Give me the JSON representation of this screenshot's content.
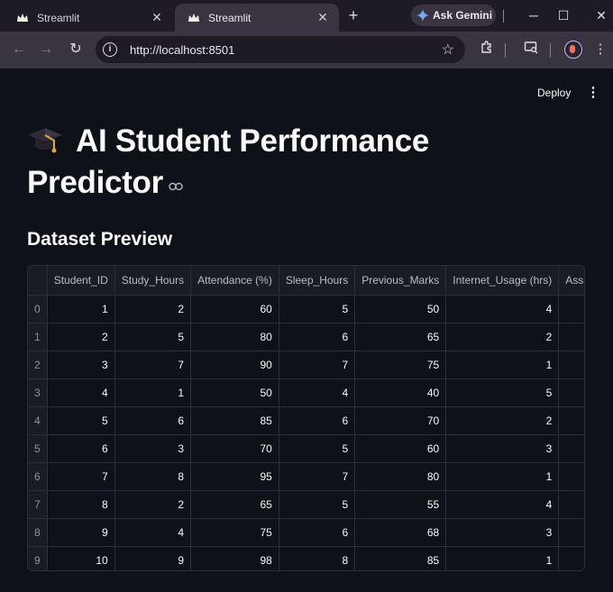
{
  "browser": {
    "tabs": [
      {
        "title": "Streamlit",
        "active": false
      },
      {
        "title": "Streamlit",
        "active": true
      }
    ],
    "new_tab": "+",
    "ask_gemini": "Ask Gemini",
    "url": "http://localhost:8501"
  },
  "app": {
    "deploy_label": "Deploy",
    "title_line1": "AI Student Performance",
    "title_line2": "Predictor",
    "subheader": "Dataset Preview"
  },
  "table": {
    "columns": [
      "",
      "Student_ID",
      "Study_Hours",
      "Attendance (%)",
      "Sleep_Hours",
      "Previous_Marks",
      "Internet_Usage (hrs)",
      "Assig"
    ],
    "rows": [
      [
        "0",
        "1",
        "2",
        "60",
        "5",
        "50",
        "4",
        ""
      ],
      [
        "1",
        "2",
        "5",
        "80",
        "6",
        "65",
        "2",
        ""
      ],
      [
        "2",
        "3",
        "7",
        "90",
        "7",
        "75",
        "1",
        ""
      ],
      [
        "3",
        "4",
        "1",
        "50",
        "4",
        "40",
        "5",
        ""
      ],
      [
        "4",
        "5",
        "6",
        "85",
        "6",
        "70",
        "2",
        ""
      ],
      [
        "5",
        "6",
        "3",
        "70",
        "5",
        "60",
        "3",
        ""
      ],
      [
        "6",
        "7",
        "8",
        "95",
        "7",
        "80",
        "1",
        ""
      ],
      [
        "7",
        "8",
        "2",
        "65",
        "5",
        "55",
        "4",
        ""
      ],
      [
        "8",
        "9",
        "4",
        "75",
        "6",
        "68",
        "3",
        ""
      ],
      [
        "9",
        "10",
        "9",
        "98",
        "8",
        "85",
        "1",
        ""
      ]
    ]
  },
  "colors": {
    "app_background": "#0e1117",
    "text": "#fafafa",
    "browser_chrome": "#3a3440"
  },
  "icons": {
    "tab_favicon": "streamlit-crown-icon",
    "title_emoji": "graduation-cap-icon",
    "heading_anchor": "link-icon"
  }
}
